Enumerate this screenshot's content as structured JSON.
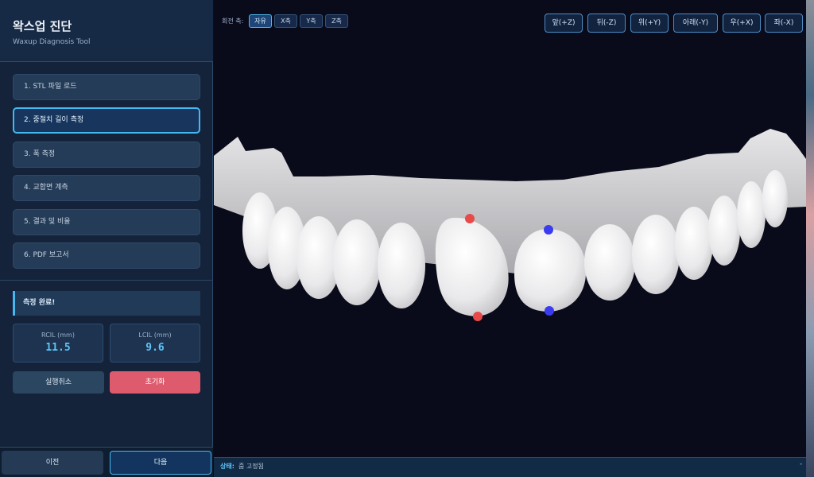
{
  "header": {
    "title": "왁스업 진단",
    "subtitle": "Waxup Diagnosis Tool"
  },
  "steps": [
    {
      "label": "1. STL 파일 로드",
      "active": false
    },
    {
      "label": "2. 중절치 길이 측정",
      "active": true
    },
    {
      "label": "3. 폭 측정",
      "active": false
    },
    {
      "label": "4. 교합면 계측",
      "active": false
    },
    {
      "label": "5. 결과 및 비율",
      "active": false
    },
    {
      "label": "6. PDF 보고서",
      "active": false
    }
  ],
  "status_message": "측정 완료!",
  "metrics": [
    {
      "label": "RCIL (mm)",
      "value": "11.5"
    },
    {
      "label": "LCIL (mm)",
      "value": "9.6"
    }
  ],
  "actions": {
    "undo_label": "실행취소",
    "reset_label": "초기화"
  },
  "footer": {
    "prev_label": "이전",
    "next_label": "다음"
  },
  "toolbar": {
    "rotation_label": "회전 축:",
    "axes": [
      {
        "label": "자유",
        "active": true
      },
      {
        "label": "X축",
        "active": false
      },
      {
        "label": "Y축",
        "active": false
      },
      {
        "label": "Z축",
        "active": false
      }
    ],
    "views": [
      "앞(+Z)",
      "뒤(-Z)",
      "위(+Y)",
      "아래(-Y)",
      "우(+X)",
      "좌(-X)"
    ]
  },
  "statusbar": {
    "key": "상태:",
    "value": "줌 고정됨",
    "indicator": "-"
  },
  "colors": {
    "accent": "#45b8f0",
    "reset": "#de5b6d",
    "marker_right": "#e84a4a",
    "marker_left": "#3b3bf0"
  }
}
